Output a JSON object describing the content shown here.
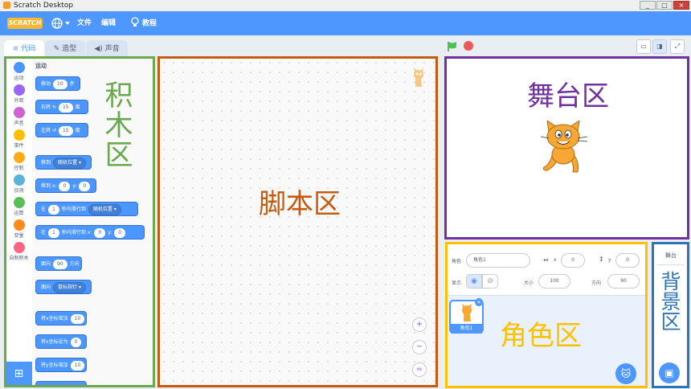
{
  "window": {
    "title": "Scratch Desktop",
    "controls": [
      "_",
      "□",
      "×"
    ]
  },
  "menubar": {
    "logo_text": "SCRATCH",
    "language_icon": "globe-icon",
    "file": "文件",
    "edit": "编辑",
    "tutorials": "教程",
    "brand_color": "#4d97ff"
  },
  "tabs": [
    {
      "label": "代码",
      "icon": "code-icon"
    },
    {
      "label": "造型",
      "icon": "brush-icon"
    },
    {
      "label": "声音",
      "icon": "speaker-icon"
    }
  ],
  "categories": [
    {
      "label": "运动",
      "color": "#4c97ff"
    },
    {
      "label": "外观",
      "color": "#9966ff"
    },
    {
      "label": "声音",
      "color": "#cf63cf"
    },
    {
      "label": "事件",
      "color": "#ffbf00"
    },
    {
      "label": "控制",
      "color": "#ffab19"
    },
    {
      "label": "侦测",
      "color": "#5cb1d6"
    },
    {
      "label": "运算",
      "color": "#59c059"
    },
    {
      "label": "变量",
      "color": "#ff8c1a"
    },
    {
      "label": "自制积木",
      "color": "#ff6680"
    }
  ],
  "palette": {
    "section_title": "运动",
    "blocks": {
      "move": {
        "label": "移动",
        "value": "10",
        "suffix": "步"
      },
      "turn_right": {
        "label": "右转",
        "icon": "rotate-right-icon",
        "value": "15",
        "suffix": "度"
      },
      "turn_left": {
        "label": "左转",
        "icon": "rotate-left-icon",
        "value": "15",
        "suffix": "度"
      },
      "goto": {
        "label": "移到",
        "dropdown": "随机位置"
      },
      "goto_xy": {
        "label": "移到 x:",
        "x": "0",
        "ylabel": "y:",
        "y": "0"
      },
      "glide_to": {
        "pre": "在",
        "value": "1",
        "mid": "秒内滑行到",
        "dropdown": "随机位置"
      },
      "glide_xy": {
        "pre": "在",
        "value": "1",
        "mid": "秒内滑行到 x:",
        "x": "0",
        "ylabel": "y:",
        "y": "0"
      },
      "point_dir": {
        "label": "面向",
        "value": "90",
        "suffix": "方向"
      },
      "point_towards": {
        "label": "面向",
        "dropdown": "鼠标指针"
      },
      "change_x": {
        "label": "将x坐标增加",
        "value": "10"
      },
      "set_x": {
        "label": "将x坐标设为",
        "value": "0"
      },
      "change_y": {
        "label": "将y坐标增加",
        "value": "10"
      }
    }
  },
  "sprite_info": {
    "sprite_label": "角色",
    "sprite_name": "角色1",
    "x_label": "x",
    "x": "0",
    "y_label": "y",
    "y": "0",
    "show_label": "显示",
    "size_label": "大小",
    "size": "100",
    "direction_label": "方向",
    "direction": "90"
  },
  "sprite_list": [
    {
      "name": "角色1"
    }
  ],
  "stage_selector": {
    "label": "舞台"
  },
  "annotations": {
    "blocks_area": {
      "text": "积木区",
      "color": "#6aa84f"
    },
    "script_area": {
      "text": "脚本区",
      "color": "#c55a11"
    },
    "stage_area": {
      "text": "舞台区",
      "color": "#7030a0"
    },
    "sprite_area": {
      "text": "角色区",
      "color": "#ffc000"
    },
    "backdrop_area": {
      "text": "背景区",
      "color": "#2e75b6"
    }
  },
  "zoom_controls": {
    "zoom_in": "+",
    "zoom_out": "−",
    "reset": "="
  },
  "run_controls": {
    "green_flag_color": "#4cbf56",
    "stop_color": "#ec5959"
  }
}
